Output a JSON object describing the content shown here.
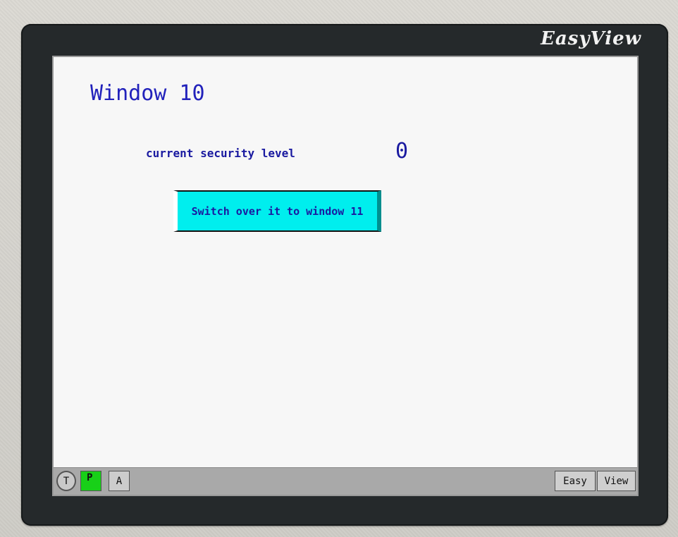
{
  "device": {
    "brand_label": "EasyView"
  },
  "screen": {
    "window_title": "Window 10",
    "security_label": "current security level",
    "security_value": "0",
    "switch_button_label": "Switch over it to window 11"
  },
  "statusbar": {
    "t_label": "T",
    "p_label": "P",
    "a_label": "A",
    "easy_label": "Easy",
    "view_label": "View"
  },
  "colors": {
    "text_blue": "#1a1aa0",
    "button_cyan": "#00eeee",
    "p_indicator_green": "#18d018",
    "bezel": "#25292b"
  }
}
